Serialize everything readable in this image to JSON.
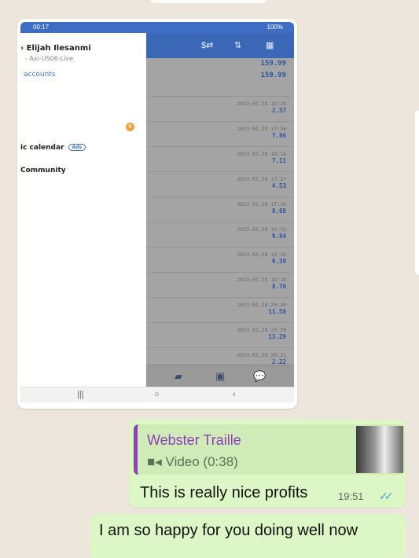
{
  "screenshot": {
    "status_left": "00:17",
    "status_right": "100%",
    "drawer": {
      "user_name": "› Elijah Ilesanmi",
      "account_server": "- Axi-US06-Live",
      "accounts_link": "accounts",
      "notification_count": "6",
      "calendar_label": "ic calendar",
      "ads_badge": "Ads",
      "community_label": "Community"
    },
    "toolbar_icons": [
      "dollar-exchange-icon",
      "sort-icon",
      "calendar-icon"
    ],
    "totals": [
      "159.99",
      "159.99"
    ],
    "trades": [
      {
        "date": "2023.03.28 18:16",
        "profit": "2.37"
      },
      {
        "date": "2023.03.28 17:38",
        "profit": "7.86"
      },
      {
        "date": "2023.03.28 18:16",
        "profit": "7.11"
      },
      {
        "date": "2023.03.28 17:27",
        "profit": "4.53"
      },
      {
        "date": "2023.03.28 17:38",
        "profit": "8.88"
      },
      {
        "date": "2023.03.28 18:16",
        "profit": "9.84"
      },
      {
        "date": "2023.03.28 18:16",
        "profit": "9.39"
      },
      {
        "date": "2023.03.28 18:16",
        "profit": "8.76"
      },
      {
        "date": "2023.03.28 20:20",
        "profit": "11.58"
      },
      {
        "date": "2023.03.28 20:20",
        "profit": "13.29"
      },
      {
        "date": "2023.03.28 20:21",
        "profit": "2.22"
      }
    ]
  },
  "reply": {
    "quoted_sender": "Webster Traille",
    "quoted_media": "Video (0:38)",
    "message": "This is really nice profits",
    "time": "19:51",
    "status_color": "#4aa3df"
  },
  "second_message": {
    "text": "I am so happy for you doing well now"
  },
  "colors": {
    "chat_background": "#ece6dc",
    "outgoing_bubble": "#dcf7c5",
    "quote_accent": "#8f3fb9",
    "app_blue": "#3a68b6"
  }
}
